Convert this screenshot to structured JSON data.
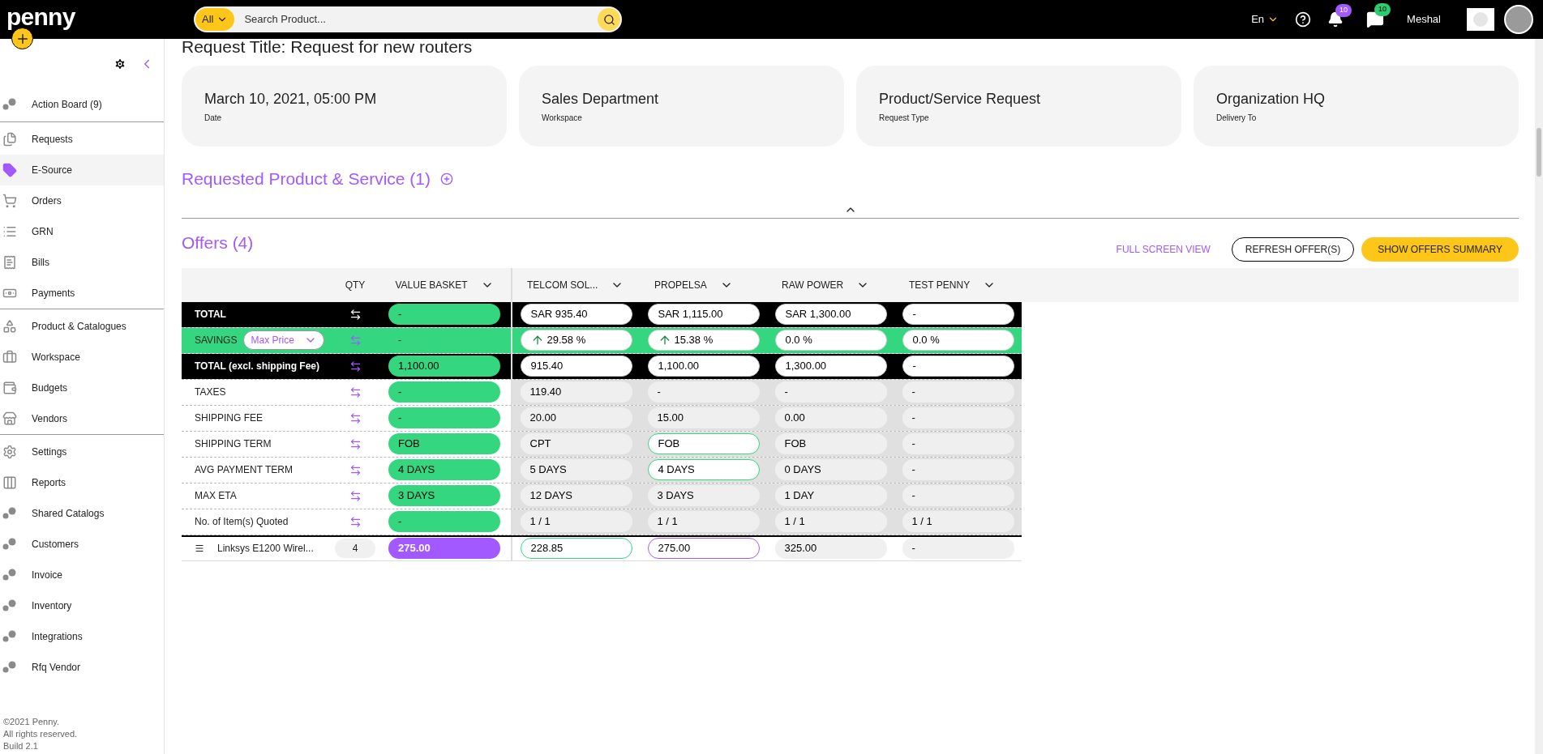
{
  "topbar": {
    "logo": "penny",
    "search_scope": "All",
    "search_placeholder": "Search Product...",
    "language": "En",
    "notifications": "10",
    "messages": "10",
    "user": "Meshal"
  },
  "sidebar": {
    "sections": [
      [
        {
          "label": "Action Board (9)",
          "selected": false
        }
      ],
      [
        {
          "label": "Requests",
          "selected": false
        },
        {
          "label": "E-Source",
          "selected": true
        },
        {
          "label": "Orders",
          "selected": false
        },
        {
          "label": "GRN",
          "selected": false
        },
        {
          "label": "Bills",
          "selected": false
        },
        {
          "label": "Payments",
          "selected": false
        }
      ],
      [
        {
          "label": "Product & Catalogues",
          "selected": false
        },
        {
          "label": "Workspace",
          "selected": false
        },
        {
          "label": "Budgets",
          "selected": false
        },
        {
          "label": "Vendors",
          "selected": false
        }
      ],
      [
        {
          "label": "Settings",
          "selected": false
        },
        {
          "label": "Reports",
          "selected": false
        },
        {
          "label": "Shared Catalogs",
          "selected": false
        },
        {
          "label": "Customers",
          "selected": false
        },
        {
          "label": "Invoice",
          "selected": false
        },
        {
          "label": "Inventory",
          "selected": false
        },
        {
          "label": "Integrations",
          "selected": false
        },
        {
          "label": "Rfq Vendor",
          "selected": false
        }
      ]
    ],
    "footer": [
      "©2021 Penny.",
      "All rights reserved.",
      "Build 2.1"
    ]
  },
  "title": "Request Title: Request for new routers",
  "cards": [
    {
      "value": "March 10, 2021, 05:00 PM",
      "label": "Date"
    },
    {
      "value": "Sales Department",
      "label": "Workspace"
    },
    {
      "value": "Product/Service Request",
      "label": "Request Type"
    },
    {
      "value": "Organization HQ",
      "label": "Delivery To"
    }
  ],
  "requested_heading": "Requested Product & Service (1)",
  "offers": {
    "heading": "Offers (4)",
    "actions": [
      "FULL SCREEN VIEW",
      "REFRESH OFFER(S)",
      "SHOW OFFERS SUMMARY"
    ],
    "qty_header": "QTY",
    "basket_header": "VALUE BASKET",
    "vendors": [
      "TELCOM SOL...",
      "PROPELSA",
      "RAW POWER",
      "TEST PENNY"
    ],
    "rows": [
      {
        "kind": "total",
        "label": "TOTAL",
        "basket": "-",
        "cells": [
          {
            "value": "SAR 935.40",
            "best": false,
            "selected": false
          },
          {
            "value": "SAR 1,115.00",
            "best": false,
            "selected": false
          },
          {
            "value": "SAR 1,300.00",
            "best": false,
            "selected": false
          },
          {
            "value": "-",
            "best": false,
            "selected": false
          }
        ]
      },
      {
        "kind": "savings",
        "label": "SAVINGS",
        "dropdown": "Max Price",
        "basket": "-",
        "cells": [
          {
            "value": "29.58 %",
            "best": false,
            "selected": false,
            "rising": true
          },
          {
            "value": "15.38 %",
            "best": false,
            "selected": false,
            "rising": true
          },
          {
            "value": "0.0 %",
            "best": false,
            "selected": false,
            "rising": false
          },
          {
            "value": "0.0 %",
            "best": false,
            "selected": false,
            "rising": false
          }
        ]
      },
      {
        "kind": "total",
        "label": "TOTAL (excl. shipping Fee)",
        "basket": "1,100.00",
        "cells": [
          {
            "value": "915.40",
            "best": false,
            "selected": false
          },
          {
            "value": "1,100.00",
            "best": false,
            "selected": false
          },
          {
            "value": "1,300.00",
            "best": false,
            "selected": false
          },
          {
            "value": "-",
            "best": false,
            "selected": false
          }
        ]
      },
      {
        "kind": "metric",
        "label": "TAXES",
        "basket": "-",
        "cells": [
          {
            "value": "119.40",
            "best": false,
            "selected": false
          },
          {
            "value": "-",
            "best": false,
            "selected": false
          },
          {
            "value": "-",
            "best": false,
            "selected": false
          },
          {
            "value": "-",
            "best": false,
            "selected": false
          }
        ]
      },
      {
        "kind": "metric",
        "label": "SHIPPING FEE",
        "basket": "-",
        "cells": [
          {
            "value": "20.00",
            "best": false,
            "selected": false
          },
          {
            "value": "15.00",
            "best": false,
            "selected": false
          },
          {
            "value": "0.00",
            "best": false,
            "selected": false
          },
          {
            "value": "-",
            "best": false,
            "selected": false
          }
        ]
      },
      {
        "kind": "metric",
        "label": "SHIPPING TERM",
        "basket": "FOB",
        "cells": [
          {
            "value": "CPT",
            "best": false,
            "selected": false
          },
          {
            "value": "FOB",
            "best": true,
            "selected": false
          },
          {
            "value": "FOB",
            "best": false,
            "selected": false
          },
          {
            "value": "-",
            "best": false,
            "selected": false
          }
        ]
      },
      {
        "kind": "metric",
        "label": "AVG PAYMENT TERM",
        "basket": "4 DAYS",
        "cells": [
          {
            "value": "5 DAYS",
            "best": false,
            "selected": false
          },
          {
            "value": "4 DAYS",
            "best": true,
            "selected": false
          },
          {
            "value": "0 DAYS",
            "best": false,
            "selected": false
          },
          {
            "value": "-",
            "best": false,
            "selected": false
          }
        ]
      },
      {
        "kind": "metric",
        "label": "MAX ETA",
        "basket": "3 DAYS",
        "cells": [
          {
            "value": "12 DAYS",
            "best": false,
            "selected": false
          },
          {
            "value": "3 DAYS",
            "best": false,
            "selected": false
          },
          {
            "value": "1 DAY",
            "best": false,
            "selected": false
          },
          {
            "value": "-",
            "best": false,
            "selected": false
          }
        ]
      },
      {
        "kind": "metric",
        "label": "No. of Item(s) Quoted",
        "basket": "-",
        "cells": [
          {
            "value": "1 / 1",
            "best": false,
            "selected": false
          },
          {
            "value": "1 / 1",
            "best": false,
            "selected": false
          },
          {
            "value": "1 / 1",
            "best": false,
            "selected": false
          },
          {
            "value": "1 / 1",
            "best": false,
            "selected": false
          }
        ]
      },
      {
        "kind": "item",
        "label": "Linksys E1200 Wirel...",
        "qty": "4",
        "basket": "275.00",
        "cells": [
          {
            "value": "228.85",
            "best": true,
            "selected": false
          },
          {
            "value": "275.00",
            "best": false,
            "selected": true
          },
          {
            "value": "325.00",
            "best": false,
            "selected": false
          },
          {
            "value": "-",
            "best": false,
            "selected": false
          }
        ]
      }
    ]
  }
}
